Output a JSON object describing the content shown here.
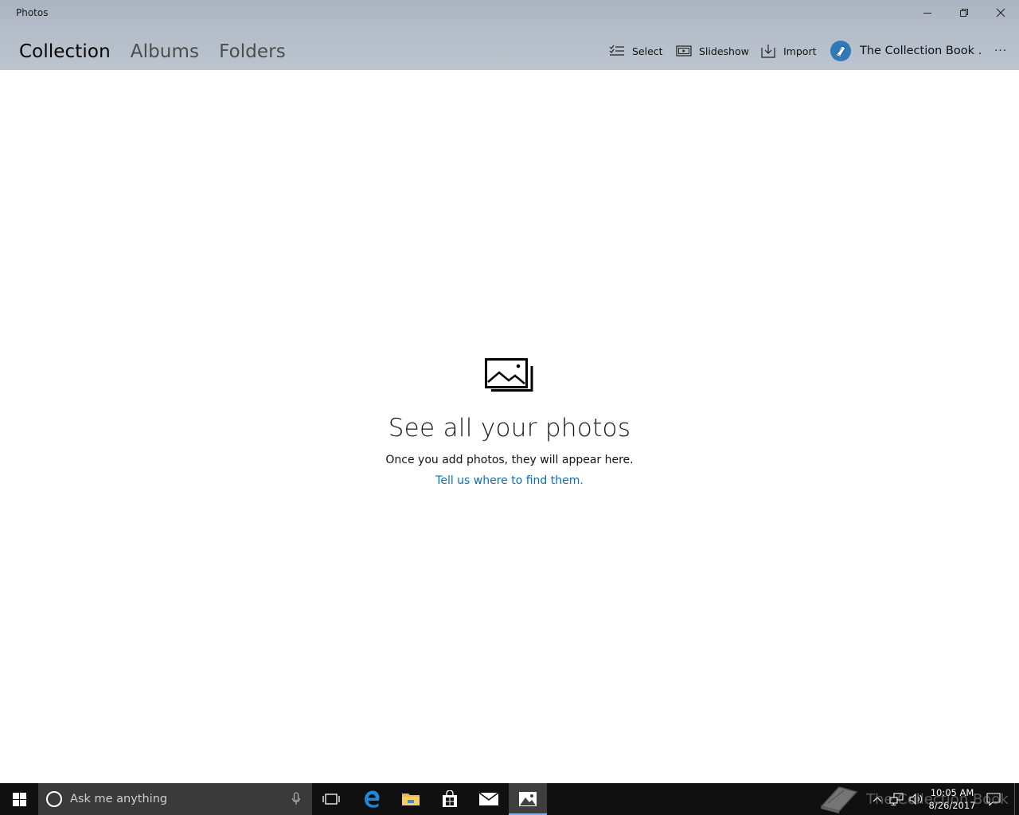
{
  "window": {
    "title": "Photos",
    "minimize_icon": "minimize-icon",
    "maximize_icon": "restore-icon",
    "close_icon": "close-icon"
  },
  "nav": {
    "tabs": [
      {
        "label": "Collection",
        "active": true
      },
      {
        "label": "Albums",
        "active": false
      },
      {
        "label": "Folders",
        "active": false
      }
    ]
  },
  "toolbar": {
    "select_label": "Select",
    "slideshow_label": "Slideshow",
    "import_label": "Import",
    "account_name": "The Collection Book .",
    "more_label": "···"
  },
  "empty_state": {
    "title": "See all your photos",
    "subtitle": "Once you add photos, they will appear here.",
    "link": "Tell us where to find them."
  },
  "taskbar": {
    "search_placeholder": "Ask me anything",
    "time": "10:05 AM",
    "date": "8/26/2017",
    "active_app": "photos"
  },
  "watermark": {
    "text": "The Collection Book"
  },
  "colors": {
    "link": "#0a6ebd",
    "taskbar": "#101010",
    "search_box": "#3a3a3a",
    "active_indicator": "#7fb2e5",
    "account_avatar": "#2f79b8"
  }
}
